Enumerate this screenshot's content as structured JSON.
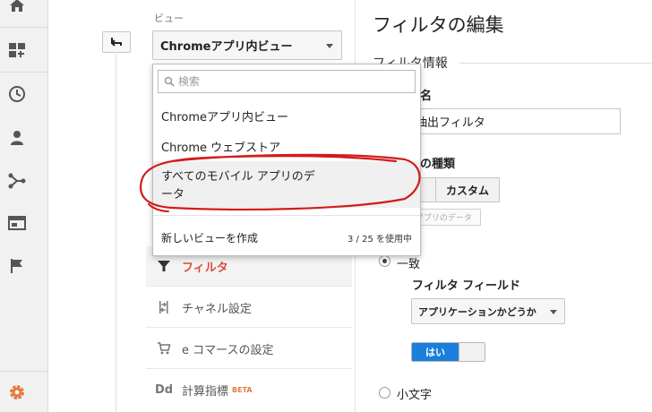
{
  "colors": {
    "accent_red": "#dd4b39",
    "toggle_blue": "#1a7fdc",
    "settings_orange": "#e37b40",
    "annotation_red": "#d21b1b"
  },
  "rail": {
    "icons": [
      "home-icon",
      "dashboard-icon",
      "clock-icon",
      "person-icon",
      "flow-icon",
      "window-icon",
      "flag-icon",
      "gear-icon"
    ]
  },
  "view": {
    "label": "ビュー",
    "selected": "Chromeアプリ内ビュー"
  },
  "dropdown": {
    "search_placeholder": "検索",
    "items": [
      "Chromeアプリ内ビュー",
      "Chrome ウェブストア",
      "すべてのモバイル アプリのデ",
      "ータ"
    ],
    "create_label": "新しいビューを作成",
    "usage": "3 / 25 を使用中"
  },
  "tooltip": "すべてのモバイル アプリのデータ",
  "menu": {
    "filter": "フィルタ",
    "channel": "チャネル設定",
    "ecommerce": "e コマースの設定",
    "calc_prefix": "Dd",
    "calc": "計算指標",
    "beta": "BETA"
  },
  "edit": {
    "title": "フィルタの編集",
    "section": "フィルタ情報",
    "name_label_partial": "名",
    "name_value_partial": "抽出フィルタ",
    "type_label_partial": "の種類",
    "custom_button": "カスタム",
    "match_partial": "一致",
    "filter_field_label": "フィルタ フィールド",
    "filter_field_value": "アプリケーションかどうか",
    "toggle_on": "はい",
    "lowercase": "小文字"
  }
}
